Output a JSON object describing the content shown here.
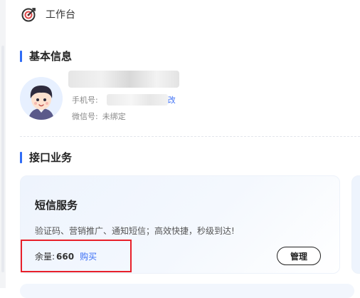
{
  "header": {
    "title": "工作台",
    "icon": "target-icon"
  },
  "basic_info": {
    "section_title": "基本信息",
    "phone_label": "手机号:",
    "edit_fragment": "改",
    "wechat_label": "微信号:",
    "wechat_value": "未绑定"
  },
  "api_business": {
    "section_title": "接口业务",
    "sms_card": {
      "title": "短信服务",
      "description": "验证码、营销推广、通知短信；高效快捷，秒级到达!",
      "quota_label": "余量:",
      "quota_value": "660",
      "buy_label": "购买",
      "manage_label": "管理"
    }
  },
  "colors": {
    "accent": "#2f6cf6",
    "link": "#3b6ef5",
    "highlight_box": "#e8202a",
    "icon_red": "#e04848"
  }
}
